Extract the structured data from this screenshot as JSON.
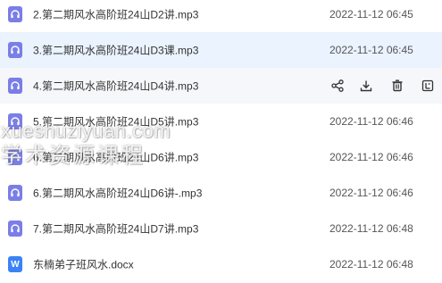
{
  "files": [
    {
      "name": "2.第二期风水高阶班24山D2讲.mp3",
      "date": "2022-11-12 06:45",
      "icon": "audio-file-icon",
      "state": "normal"
    },
    {
      "name": "3.第二期风水高阶班24山D3课.mp3",
      "date": "2022-11-12 06:45",
      "icon": "audio-file-icon",
      "state": "selected"
    },
    {
      "name": "4.第二期风水高阶班24山D4讲.mp3",
      "date": "",
      "icon": "audio-file-icon",
      "state": "hovered"
    },
    {
      "name": "5.第二期风水高阶班24山D5讲.mp3",
      "date": "2022-11-12 06:46",
      "icon": "audio-file-icon",
      "state": "normal"
    },
    {
      "name": "6.第二期风水高阶班24山D6讲.mp3",
      "date": "2022-11-12 06:46",
      "icon": "audio-file-icon",
      "state": "normal"
    },
    {
      "name": "6.第二期风水高阶班24山D6讲-.mp3",
      "date": "2022-11-12 06:46",
      "icon": "audio-file-icon",
      "state": "normal"
    },
    {
      "name": "7.第二期风水高阶班24山D7讲.mp3",
      "date": "2022-11-12 06:48",
      "icon": "audio-file-icon",
      "state": "normal"
    },
    {
      "name": "东楠弟子班风水.docx",
      "date": "2022-11-12 06:48",
      "icon": "word-file-icon",
      "state": "normal"
    }
  ],
  "hover_actions": [
    "share-icon",
    "download-icon",
    "delete-icon",
    "more-icon"
  ],
  "word_icon_letter": "W",
  "watermark": {
    "line1": "xueshuziyuan.com",
    "line2": "学术资源课程"
  },
  "colors": {
    "selected_row": "#eaf3fe",
    "hover_row": "#f5f7fa",
    "audio_icon": "#7a7ee6",
    "doc_icon": "#3b82f6"
  }
}
